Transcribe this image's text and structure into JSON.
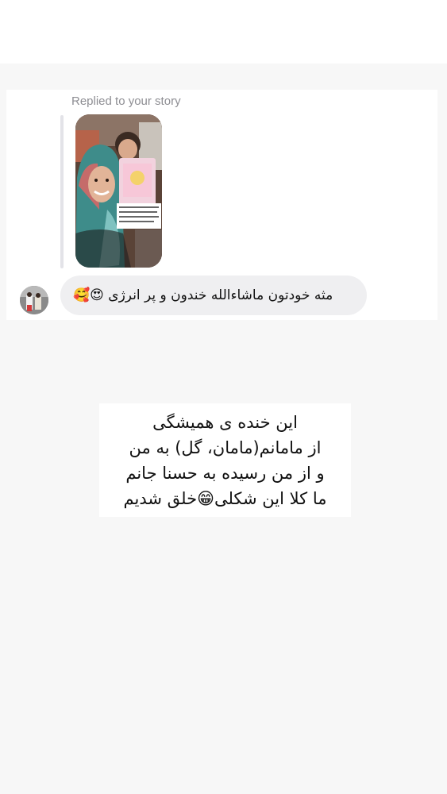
{
  "reply": {
    "label": "Replied to your story",
    "story_caption_lines": [
      "امروز با هستی جون حسنا گلی",
      "تولد داشتیم ، که بیاد دوران به",
      "مون بیست تا امرتیکا دوزانه",
      "که هتیتای همراه‌موت خوشحالم، عزیز"
    ]
  },
  "message": {
    "text": "مثه خودتون ماشاءالله خندون و پر انرژی 😍🥰"
  },
  "caption": {
    "lines": [
      "این خنده ی همیشگی",
      "از مامانم(مامان، گل) به من",
      "و از من رسیده به حسنا جانم",
      "ما کلا این شکلی😁خلق شدیم"
    ]
  },
  "icons": {
    "avatar": "profile-avatar",
    "story": "story-thumbnail"
  }
}
